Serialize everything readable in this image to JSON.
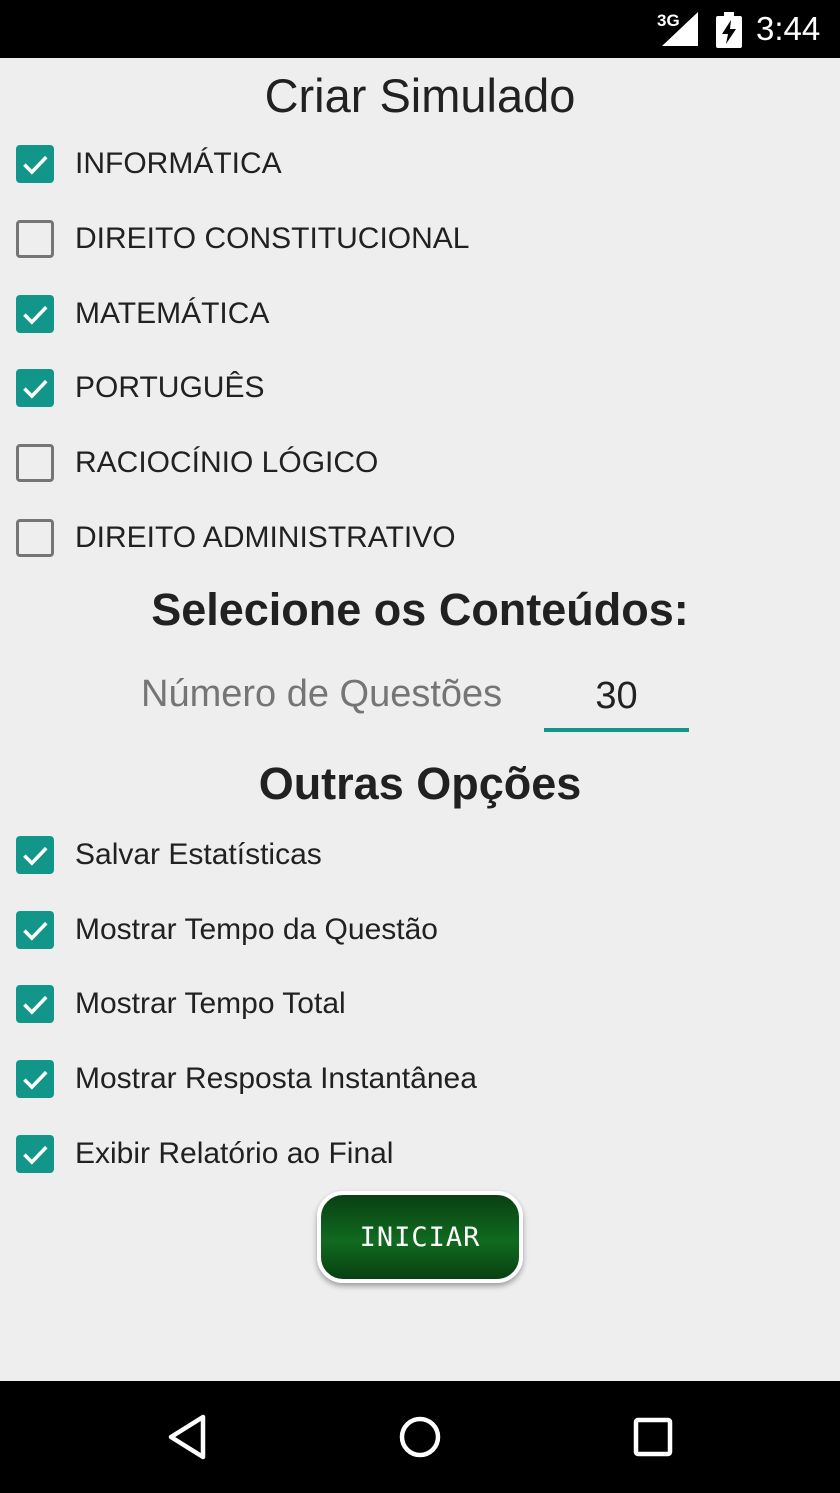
{
  "status_bar": {
    "network": "3G",
    "time": "3:44"
  },
  "title": "Criar Simulado",
  "subjects": [
    {
      "label": "INFORMÁTICA",
      "checked": true
    },
    {
      "label": "DIREITO CONSTITUCIONAL",
      "checked": false
    },
    {
      "label": "MATEMÁTICA",
      "checked": true
    },
    {
      "label": "PORTUGUÊS",
      "checked": true
    },
    {
      "label": "RACIOCÍNIO LÓGICO",
      "checked": false
    },
    {
      "label": "DIREITO ADMINISTRATIVO",
      "checked": false
    }
  ],
  "contents_heading": "Selecione os Conteúdos:",
  "questions": {
    "label": "Número de Questões",
    "value": "30"
  },
  "options_heading": "Outras Opções",
  "options": [
    {
      "label": "Salvar Estatísticas",
      "checked": true
    },
    {
      "label": "Mostrar Tempo da Questão",
      "checked": true
    },
    {
      "label": "Mostrar Tempo Total",
      "checked": true
    },
    {
      "label": "Mostrar Resposta Instantânea",
      "checked": true
    },
    {
      "label": "Exibir Relatório ao Final",
      "checked": true
    }
  ],
  "start_button": "INICIAR",
  "colors": {
    "accent": "#12968a",
    "button": "#106b1f",
    "background": "#eeeeee"
  }
}
